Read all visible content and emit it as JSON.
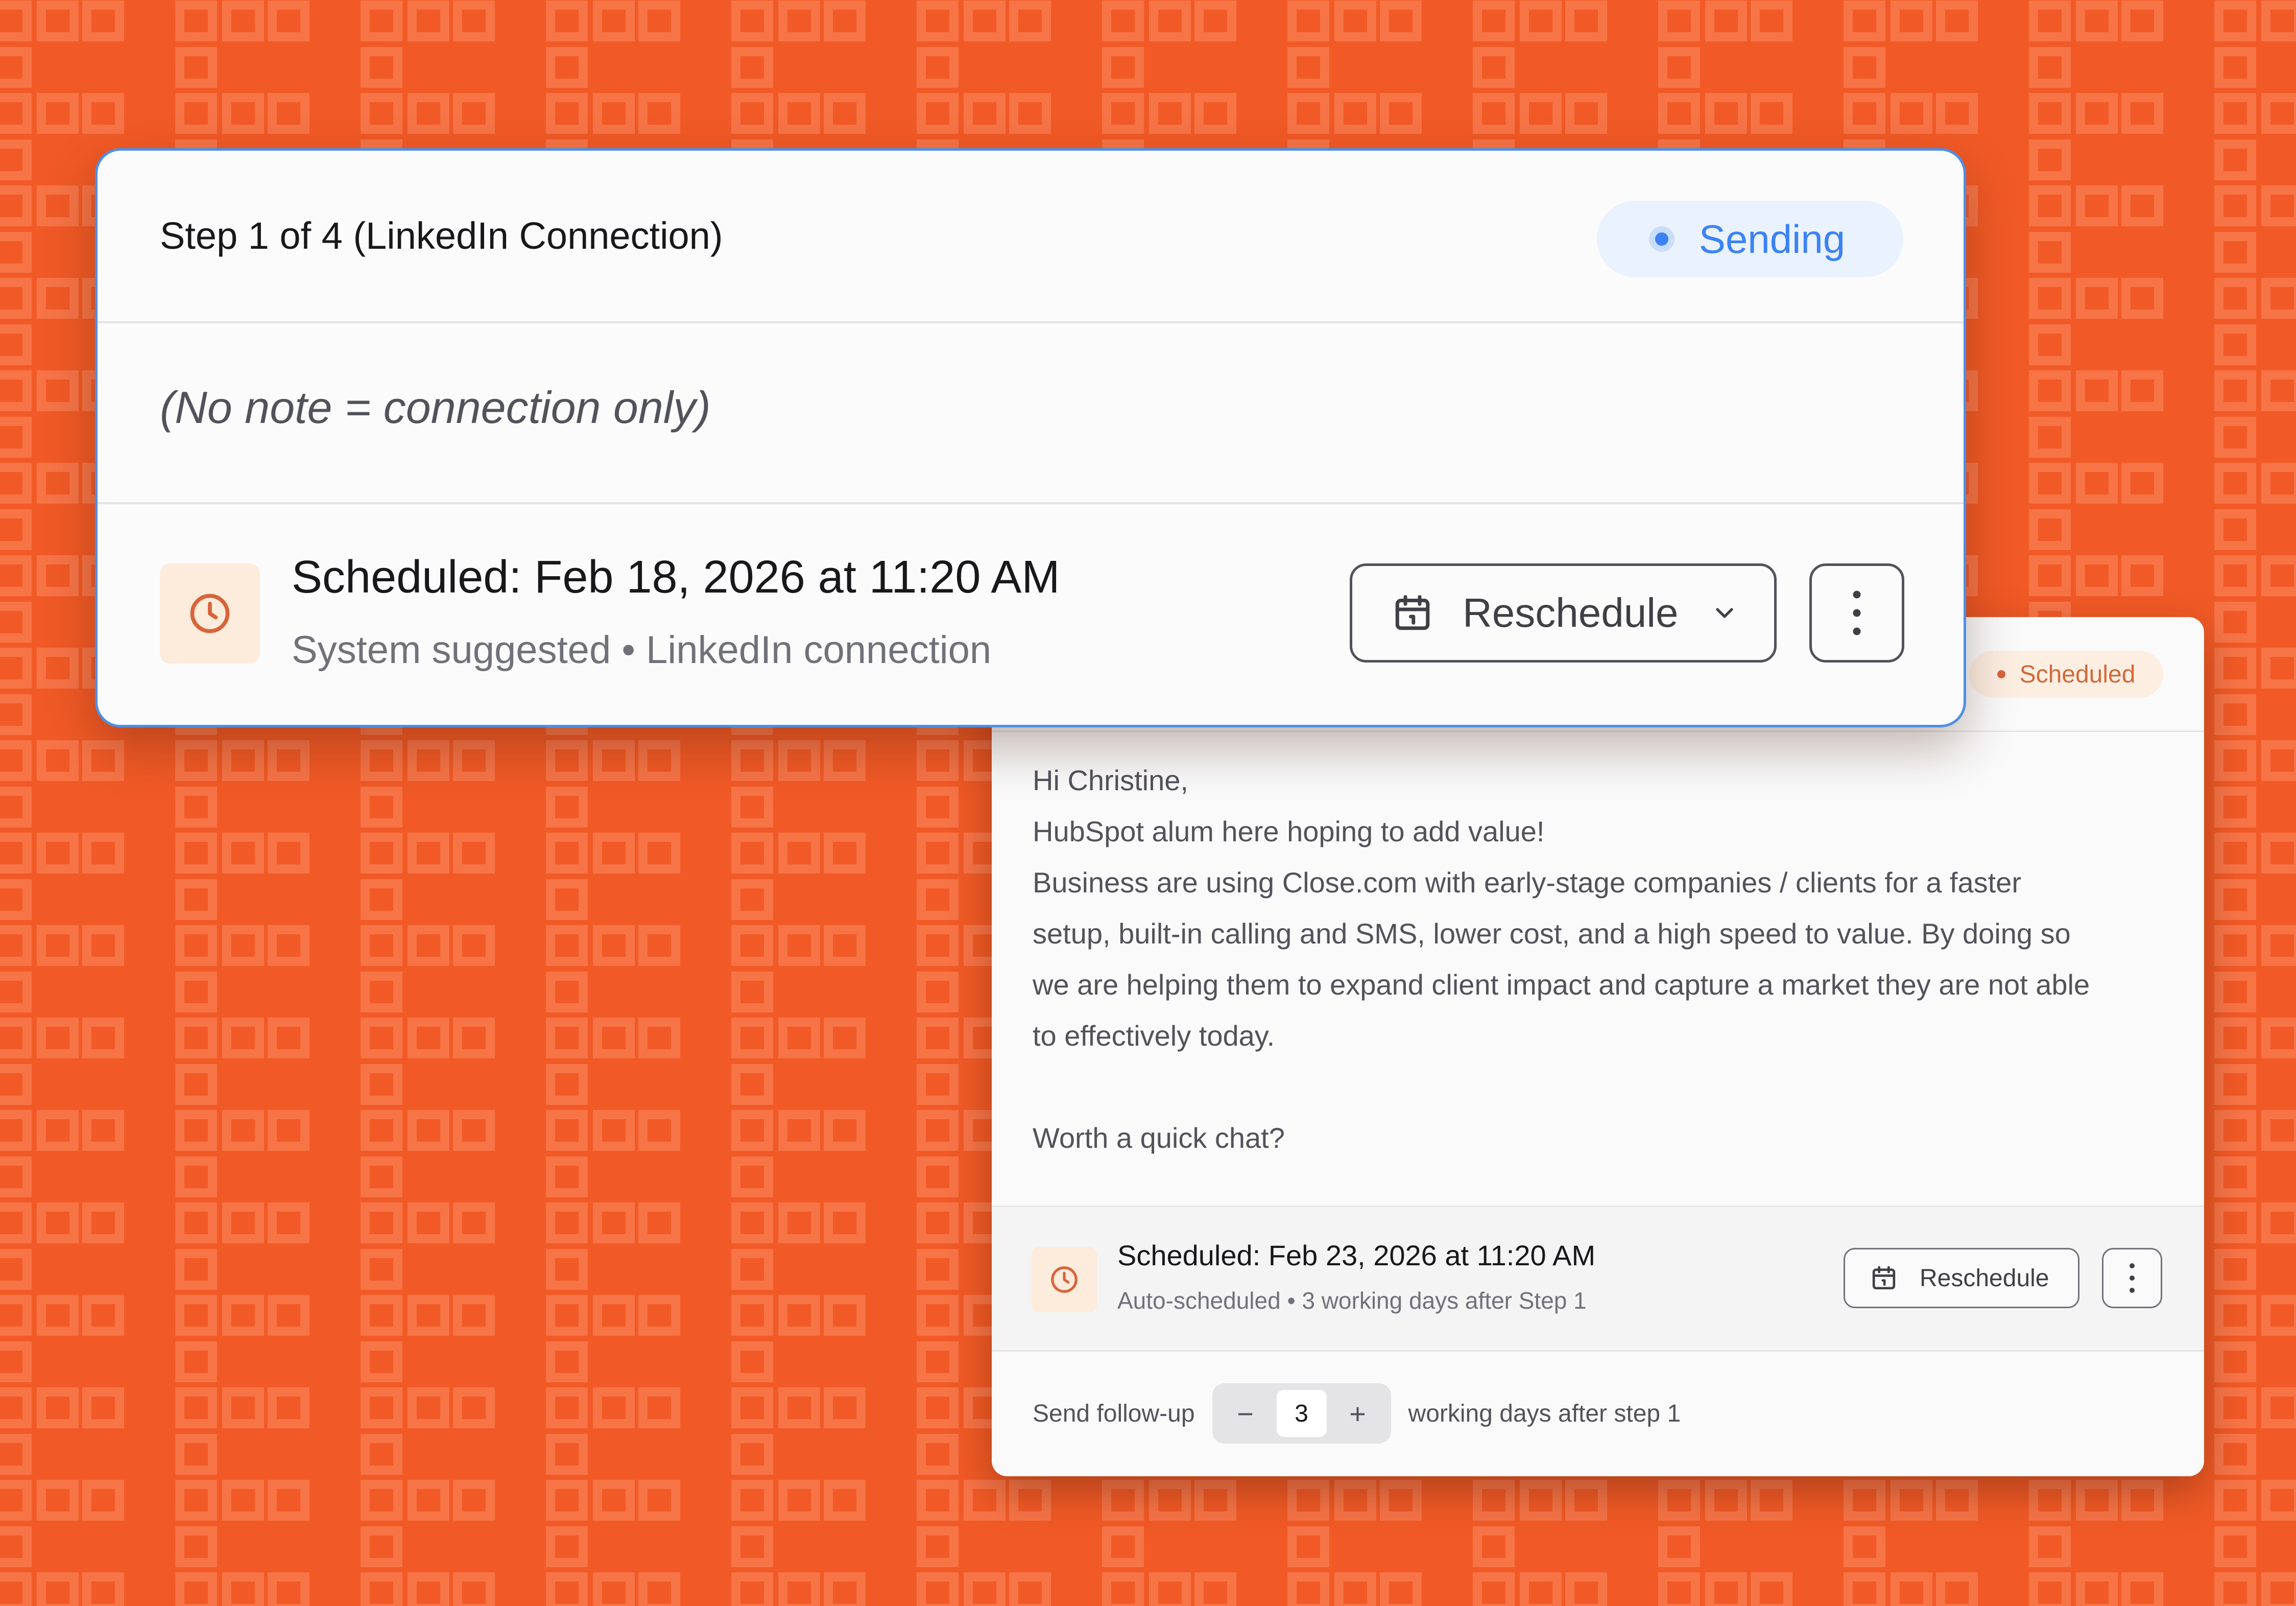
{
  "colors": {
    "background": "#f15a26",
    "pattern": "#f8774a",
    "accent_blue": "#3b82f6",
    "card_border_active": "#4d8fe6",
    "scheduled_badge_bg": "#fdeee2",
    "scheduled_badge_text": "#d06a3a",
    "clock_tile_bg": "#fdebdb",
    "clock_icon": "#d8643a"
  },
  "step1": {
    "title": "Step 1 of 4 (LinkedIn Connection)",
    "status": "Sending",
    "note": "(No note = connection only)",
    "scheduled_title": "Scheduled: Feb 18, 2026 at 11:20 AM",
    "scheduled_subtitle": "System suggested • LinkedIn connection",
    "reschedule_label": "Reschedule",
    "icons": {
      "clock": "clock-icon",
      "calendar": "calendar-icon",
      "chevron": "chevron-down-icon",
      "more": "more-vertical-icon"
    }
  },
  "step2": {
    "status": "Scheduled",
    "message_lines": [
      "Hi Christine,",
      "HubSpot alum here hoping to add value!",
      "Business are using Close.com with early-stage companies / clients for a faster",
      "setup, built-in calling and SMS, lower cost, and a high speed to value. By doing so",
      "we are helping them to expand client impact and capture a market they are not able",
      "to effectively today.",
      "",
      "Worth a quick chat?"
    ],
    "scheduled_title": "Scheduled: Feb 23, 2026 at 11:20 AM",
    "scheduled_subtitle": "Auto-scheduled • 3 working days after Step 1",
    "reschedule_label": "Reschedule",
    "followup": {
      "prefix": "Send follow-up",
      "decrement": "−",
      "value": "3",
      "increment": "+",
      "suffix": "working days after step 1"
    }
  }
}
